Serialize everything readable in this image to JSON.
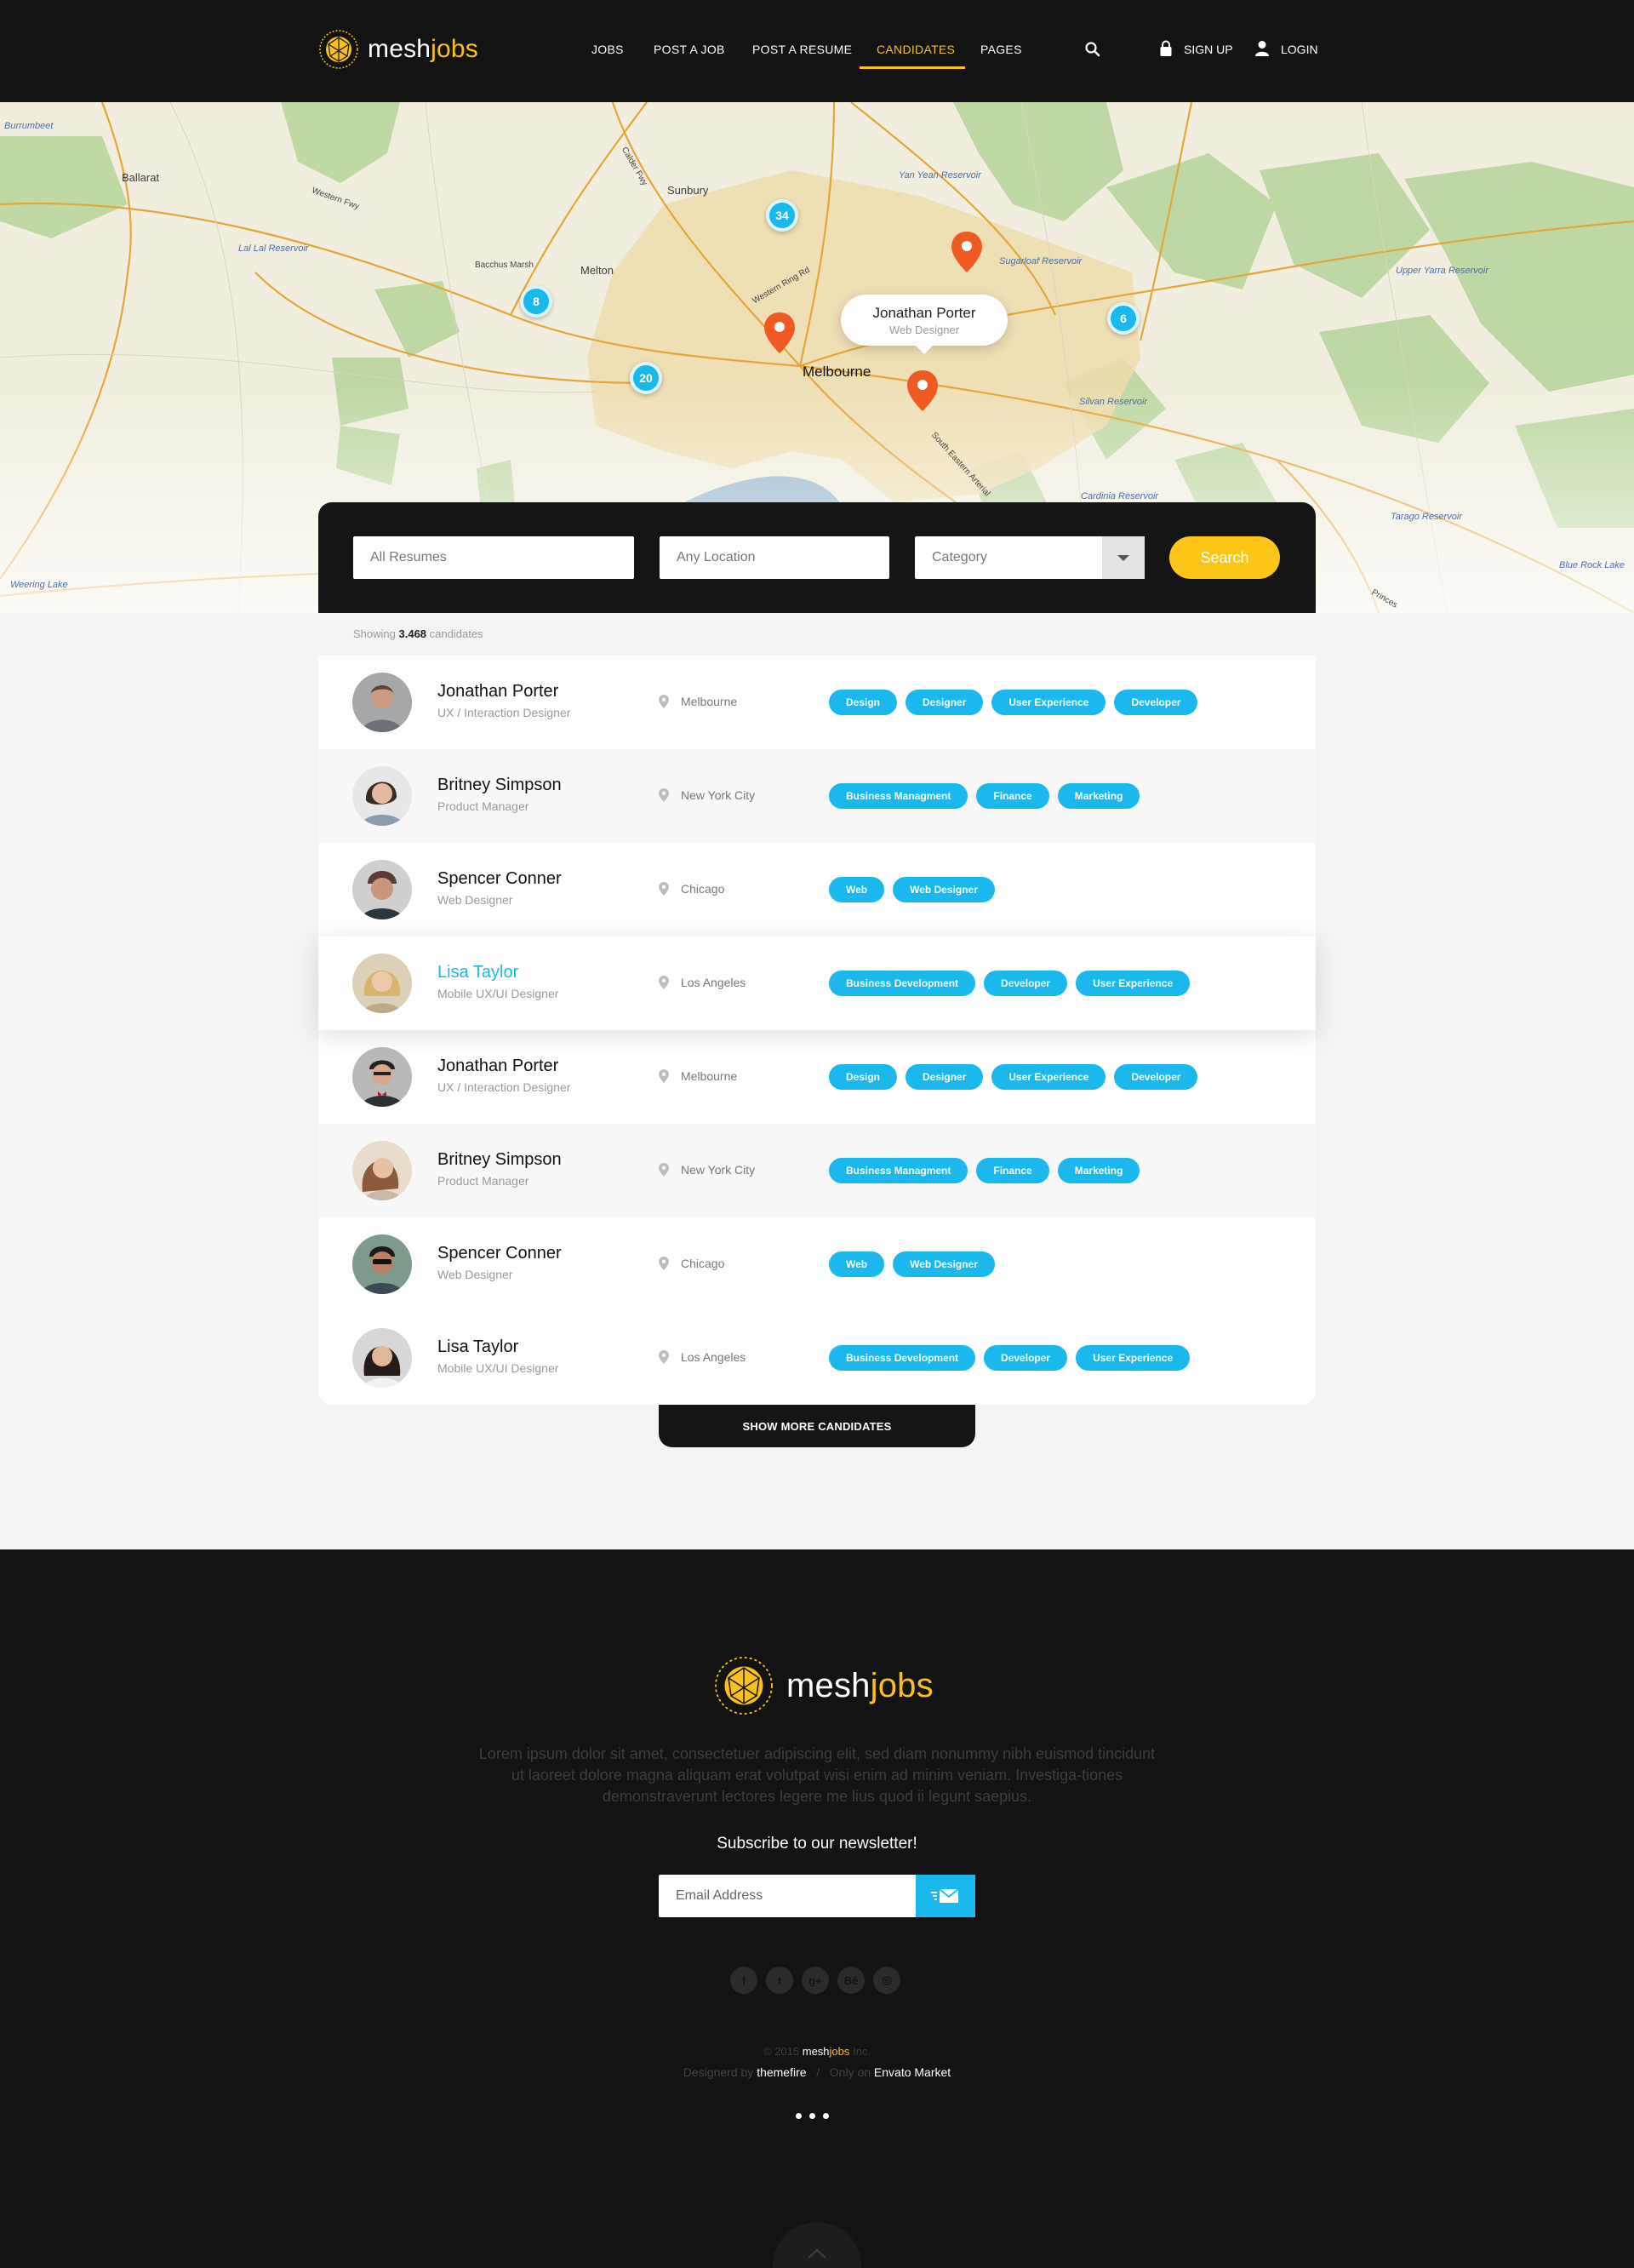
{
  "brand": {
    "name_prefix": "mesh",
    "name_suffix": "jobs"
  },
  "nav": {
    "items": [
      {
        "label": "JOBS"
      },
      {
        "label": "POST A JOB"
      },
      {
        "label": "POST A RESUME"
      },
      {
        "label": "CANDIDATES",
        "active": true
      },
      {
        "label": "PAGES"
      }
    ],
    "search_icon": "search-icon",
    "signup_label": "SIGN UP",
    "login_label": "LOGIN"
  },
  "map": {
    "labels": {
      "ballarat": "Ballarat",
      "sunbury": "Sunbury",
      "bacchus": "Bacchus Marsh",
      "melton": "Melton",
      "melbourne": "Melbourne",
      "lallal": "Lal Lal Reservoir",
      "yanyean": "Yan Yean Reservoir",
      "sugarloaf": "Sugarloaf Reservoir",
      "silvan": "Silvan Reservoir",
      "cardinia": "Cardinia Reservoir",
      "tarago": "Tarago Reservoir",
      "bluerock": "Blue Rock Lake",
      "weering": "Weering Lake",
      "burrumbeet": "Burrumbeet",
      "upperyarra": "Upper Yarra Reservoir",
      "westernfwy": "Western Fwy",
      "calder": "Calder Fwy",
      "ringrd": "Western Ring Rd",
      "sefwy": "South Eastern Arterial",
      "princes": "Princes"
    },
    "clusters": [
      "34",
      "8",
      "20",
      "6"
    ],
    "popup": {
      "name": "Jonathan Porter",
      "role": "Web Designer"
    }
  },
  "search": {
    "keywords_placeholder": "All Resumes",
    "location_placeholder": "Any Location",
    "category_placeholder": "Category",
    "button_label": "Search"
  },
  "results": {
    "prefix": "Showing",
    "count": "3.468",
    "suffix": "candidates"
  },
  "candidates": [
    {
      "name": "Jonathan Porter",
      "role": "UX / Interaction Designer",
      "location": "Melbourne",
      "tags": [
        "Design",
        "Designer",
        "User Experience",
        "Developer"
      ]
    },
    {
      "name": "Britney Simpson",
      "role": "Product Manager",
      "location": "New York City",
      "tags": [
        "Business Managment",
        "Finance",
        "Marketing"
      ]
    },
    {
      "name": "Spencer Conner",
      "role": "Web Designer",
      "location": "Chicago",
      "tags": [
        "Web",
        "Web Designer"
      ]
    },
    {
      "name": "Lisa Taylor",
      "role": "Mobile UX/UI Designer",
      "location": "Los Angeles",
      "tags": [
        "Business Development",
        "Developer",
        "User Experience"
      ],
      "highlighted": true
    },
    {
      "name": "Jonathan Porter",
      "role": "UX / Interaction Designer",
      "location": "Melbourne",
      "tags": [
        "Design",
        "Designer",
        "User Experience",
        "Developer"
      ]
    },
    {
      "name": "Britney Simpson",
      "role": "Product Manager",
      "location": "New York City",
      "tags": [
        "Business Managment",
        "Finance",
        "Marketing"
      ]
    },
    {
      "name": "Spencer Conner",
      "role": "Web Designer",
      "location": "Chicago",
      "tags": [
        "Web",
        "Web Designer"
      ]
    },
    {
      "name": "Lisa Taylor",
      "role": "Mobile UX/UI Designer",
      "location": "Los Angeles",
      "tags": [
        "Business Development",
        "Developer",
        "User Experience"
      ]
    }
  ],
  "show_more_label": "SHOW MORE CANDIDATES",
  "footer": {
    "description": "Lorem ipsum dolor sit amet, consectetuer adipiscing elit, sed diam nonummy nibh euismod tincidunt ut laoreet dolore magna aliquam erat volutpat wisi enim ad minim veniam. Investiga-tiones demonstraverunt lectores legere me lius quod ii legunt saepius.",
    "newsletter_title": "Subscribe to our newsletter!",
    "email_placeholder": "Email Address",
    "socials": [
      "facebook-icon",
      "twitter-icon",
      "google-plus-icon",
      "behance-icon",
      "dribbble-icon"
    ],
    "copyright_year": "© 2015",
    "copyright_brand_prefix": "mesh",
    "copyright_brand_suffix": "jobs",
    "copyright_suffix": "Inc.",
    "designed_by_label": "Designerd by",
    "designer": "themefire",
    "separator": "/",
    "only_on_label": "Only on",
    "market": "Envato Market"
  },
  "colors": {
    "accent": "#1ab8ec",
    "brand": "#f7c01a",
    "pin": "#ef5a24",
    "dark": "#131313"
  }
}
